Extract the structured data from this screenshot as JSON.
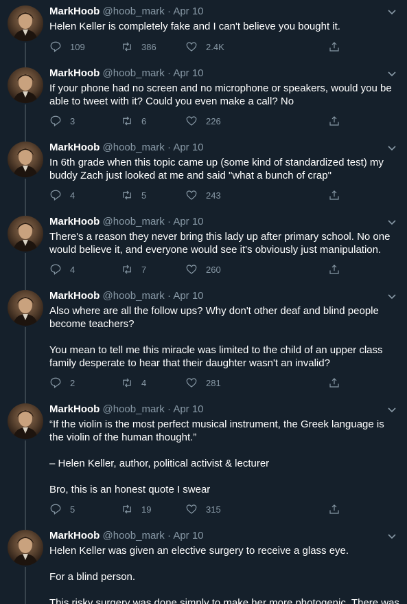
{
  "tweets": [
    {
      "name": "MarkHoob",
      "handle": "@hoob_mark",
      "date": "Apr 10",
      "paragraphs": [
        "Helen Keller is completely fake and I can't believe you bought it."
      ],
      "replies": "109",
      "retweets": "386",
      "likes": "2.4K"
    },
    {
      "name": "MarkHoob",
      "handle": "@hoob_mark",
      "date": "Apr 10",
      "paragraphs": [
        "If your phone had no screen and no microphone or speakers, would you be able to tweet with it? Could you even make a call? No"
      ],
      "replies": "3",
      "retweets": "6",
      "likes": "226"
    },
    {
      "name": "MarkHoob",
      "handle": "@hoob_mark",
      "date": "Apr 10",
      "paragraphs": [
        "In 6th grade when this topic came up (some kind of standardized test) my buddy Zach just looked at me and said \"what a bunch of crap\""
      ],
      "replies": "4",
      "retweets": "5",
      "likes": "243"
    },
    {
      "name": "MarkHoob",
      "handle": "@hoob_mark",
      "date": "Apr 10",
      "paragraphs": [
        "There's a reason they never bring this lady up after primary school. No one would believe it, and everyone would see it's obviously just manipulation."
      ],
      "replies": "4",
      "retweets": "7",
      "likes": "260"
    },
    {
      "name": "MarkHoob",
      "handle": "@hoob_mark",
      "date": "Apr 10",
      "paragraphs": [
        "Also where are all the follow ups? Why don't other deaf and blind people become teachers?",
        "You mean to tell me this miracle was limited to the child of an upper class family desperate to hear that their daughter wasn't an invalid?"
      ],
      "replies": "2",
      "retweets": "4",
      "likes": "281"
    },
    {
      "name": "MarkHoob",
      "handle": "@hoob_mark",
      "date": "Apr 10",
      "paragraphs": [
        "“If the violin is the most perfect musical instrument, the Greek language is the violin of the human thought.”",
        "– Helen Keller, author, political activist & lecturer",
        "Bro, this is an honest quote I swear"
      ],
      "replies": "5",
      "retweets": "19",
      "likes": "315"
    },
    {
      "name": "MarkHoob",
      "handle": "@hoob_mark",
      "date": "Apr 10",
      "paragraphs": [
        "Helen Keller was given an elective surgery to receive a glass eye.",
        "For a blind person.",
        "This risky surgery was done simply to make her more photogenic. There was"
      ],
      "replies": "",
      "retweets": "",
      "likes": ""
    }
  ],
  "icons": {
    "reply": "reply-icon",
    "retweet": "retweet-icon",
    "like": "heart-icon",
    "share": "share-icon",
    "caret": "chevron-down-icon"
  },
  "colors": {
    "background": "#15202b",
    "secondary_text": "#8899a6",
    "thread_line": "#38444d"
  }
}
